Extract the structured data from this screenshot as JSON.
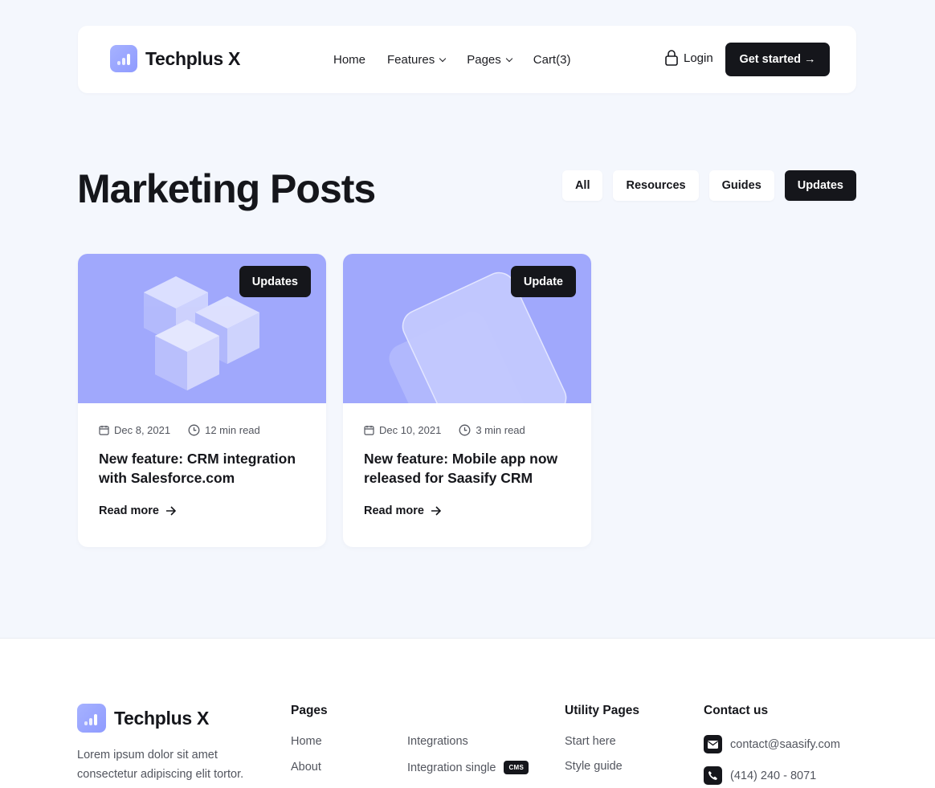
{
  "brand": {
    "name": "Techplus X"
  },
  "nav": {
    "items": [
      {
        "label": "Home",
        "dropdown": false
      },
      {
        "label": "Features",
        "dropdown": true
      },
      {
        "label": "Pages",
        "dropdown": true
      },
      {
        "label": "Cart(3)",
        "dropdown": false
      }
    ],
    "login_label": "Login",
    "cta_label": "Get started →"
  },
  "page": {
    "title": "Marketing Posts"
  },
  "filters": [
    {
      "label": "All",
      "active": false
    },
    {
      "label": "Resources",
      "active": false
    },
    {
      "label": "Guides",
      "active": false
    },
    {
      "label": "Updates",
      "active": true
    }
  ],
  "posts": [
    {
      "badge": "Updates",
      "date": "Dec 8, 2021",
      "read_time": "12 min read",
      "title": "New feature: CRM integration with Salesforce.com",
      "read_more": "Read more",
      "illustration": "cubes"
    },
    {
      "badge": "Update",
      "date": "Dec 10, 2021",
      "read_time": "3 min read",
      "title": "New feature: Mobile app now released for Saasify CRM",
      "read_more": "Read more",
      "illustration": "glass-cards"
    }
  ],
  "footer": {
    "description": "Lorem ipsum dolor sit amet consectetur adipiscing elit tortor.",
    "pages_heading": "Pages",
    "pages_col1": [
      "Home",
      "About"
    ],
    "pages_col2": [
      "Integrations",
      "Integration single"
    ],
    "cms_badge": "CMS",
    "utility_heading": "Utility Pages",
    "utility_links": [
      "Start here",
      "Style guide"
    ],
    "contact_heading": "Contact us",
    "email": "contact@saasify.com",
    "phone": "(414) 240 - 8071"
  },
  "colors": {
    "accent": "#a0a8fc",
    "dark": "#15161b",
    "background": "#f4f7fd"
  }
}
